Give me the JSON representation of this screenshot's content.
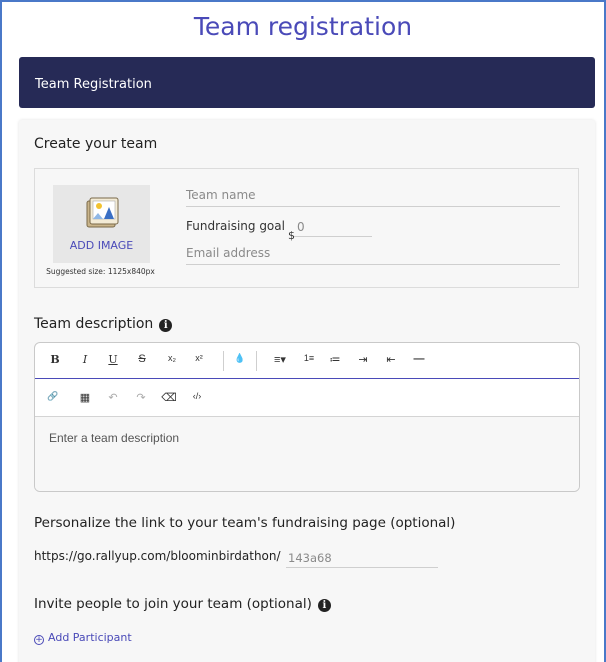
{
  "page": {
    "title": "Team registration"
  },
  "navbar": {
    "label": "Team Registration"
  },
  "create_team": {
    "heading": "Create your team",
    "add_image_label": "ADD IMAGE",
    "suggested_size": "Suggested size: 1125x840px",
    "team_name_placeholder": "Team name",
    "fundraising_goal_label": "Fundraising goal",
    "currency_symbol": "$",
    "fundraising_goal_value": "0",
    "email_placeholder": "Email address"
  },
  "description": {
    "heading": "Team description",
    "info_glyph": "i",
    "toolbar_row1": [
      "B",
      "I",
      "U",
      "S",
      "x₂",
      "x²",
      "💧",
      "≡▾",
      "1≡",
      "≔",
      "⇥",
      "⇤",
      "—"
    ],
    "toolbar_row2": [
      "🔗",
      "▦",
      "↶",
      "↷",
      "⌫",
      "‹/›"
    ],
    "placeholder": "Enter a team description"
  },
  "link": {
    "heading": "Personalize the link to your team's fundraising page (optional)",
    "prefix": "https://go.rallyup.com/bloominbirdathon/",
    "slug": "143a68"
  },
  "invite": {
    "heading": "Invite people to join your team (optional)",
    "add_participant": "Add Participant",
    "plus_glyph": "+"
  },
  "colors": {
    "accent": "#4a4ab8",
    "navbar": "#262a56",
    "frame_border": "#4a78c8"
  }
}
